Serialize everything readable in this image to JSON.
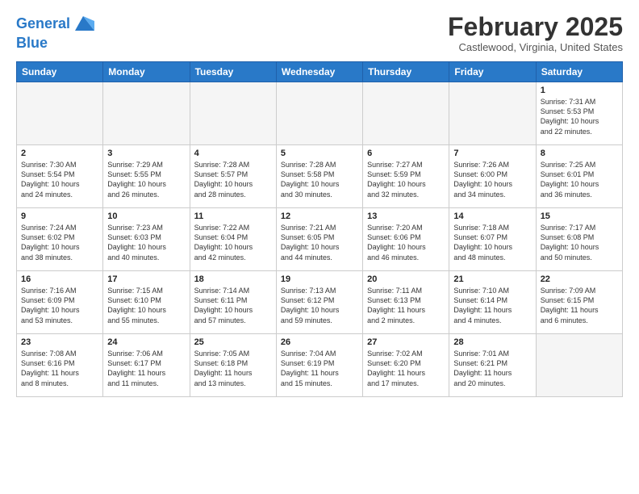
{
  "header": {
    "logo_line1": "General",
    "logo_line2": "Blue",
    "month_title": "February 2025",
    "subtitle": "Castlewood, Virginia, United States"
  },
  "weekdays": [
    "Sunday",
    "Monday",
    "Tuesday",
    "Wednesday",
    "Thursday",
    "Friday",
    "Saturday"
  ],
  "weeks": [
    [
      {
        "day": "",
        "info": ""
      },
      {
        "day": "",
        "info": ""
      },
      {
        "day": "",
        "info": ""
      },
      {
        "day": "",
        "info": ""
      },
      {
        "day": "",
        "info": ""
      },
      {
        "day": "",
        "info": ""
      },
      {
        "day": "1",
        "info": "Sunrise: 7:31 AM\nSunset: 5:53 PM\nDaylight: 10 hours\nand 22 minutes."
      }
    ],
    [
      {
        "day": "2",
        "info": "Sunrise: 7:30 AM\nSunset: 5:54 PM\nDaylight: 10 hours\nand 24 minutes."
      },
      {
        "day": "3",
        "info": "Sunrise: 7:29 AM\nSunset: 5:55 PM\nDaylight: 10 hours\nand 26 minutes."
      },
      {
        "day": "4",
        "info": "Sunrise: 7:28 AM\nSunset: 5:57 PM\nDaylight: 10 hours\nand 28 minutes."
      },
      {
        "day": "5",
        "info": "Sunrise: 7:28 AM\nSunset: 5:58 PM\nDaylight: 10 hours\nand 30 minutes."
      },
      {
        "day": "6",
        "info": "Sunrise: 7:27 AM\nSunset: 5:59 PM\nDaylight: 10 hours\nand 32 minutes."
      },
      {
        "day": "7",
        "info": "Sunrise: 7:26 AM\nSunset: 6:00 PM\nDaylight: 10 hours\nand 34 minutes."
      },
      {
        "day": "8",
        "info": "Sunrise: 7:25 AM\nSunset: 6:01 PM\nDaylight: 10 hours\nand 36 minutes."
      }
    ],
    [
      {
        "day": "9",
        "info": "Sunrise: 7:24 AM\nSunset: 6:02 PM\nDaylight: 10 hours\nand 38 minutes."
      },
      {
        "day": "10",
        "info": "Sunrise: 7:23 AM\nSunset: 6:03 PM\nDaylight: 10 hours\nand 40 minutes."
      },
      {
        "day": "11",
        "info": "Sunrise: 7:22 AM\nSunset: 6:04 PM\nDaylight: 10 hours\nand 42 minutes."
      },
      {
        "day": "12",
        "info": "Sunrise: 7:21 AM\nSunset: 6:05 PM\nDaylight: 10 hours\nand 44 minutes."
      },
      {
        "day": "13",
        "info": "Sunrise: 7:20 AM\nSunset: 6:06 PM\nDaylight: 10 hours\nand 46 minutes."
      },
      {
        "day": "14",
        "info": "Sunrise: 7:18 AM\nSunset: 6:07 PM\nDaylight: 10 hours\nand 48 minutes."
      },
      {
        "day": "15",
        "info": "Sunrise: 7:17 AM\nSunset: 6:08 PM\nDaylight: 10 hours\nand 50 minutes."
      }
    ],
    [
      {
        "day": "16",
        "info": "Sunrise: 7:16 AM\nSunset: 6:09 PM\nDaylight: 10 hours\nand 53 minutes."
      },
      {
        "day": "17",
        "info": "Sunrise: 7:15 AM\nSunset: 6:10 PM\nDaylight: 10 hours\nand 55 minutes."
      },
      {
        "day": "18",
        "info": "Sunrise: 7:14 AM\nSunset: 6:11 PM\nDaylight: 10 hours\nand 57 minutes."
      },
      {
        "day": "19",
        "info": "Sunrise: 7:13 AM\nSunset: 6:12 PM\nDaylight: 10 hours\nand 59 minutes."
      },
      {
        "day": "20",
        "info": "Sunrise: 7:11 AM\nSunset: 6:13 PM\nDaylight: 11 hours\nand 2 minutes."
      },
      {
        "day": "21",
        "info": "Sunrise: 7:10 AM\nSunset: 6:14 PM\nDaylight: 11 hours\nand 4 minutes."
      },
      {
        "day": "22",
        "info": "Sunrise: 7:09 AM\nSunset: 6:15 PM\nDaylight: 11 hours\nand 6 minutes."
      }
    ],
    [
      {
        "day": "23",
        "info": "Sunrise: 7:08 AM\nSunset: 6:16 PM\nDaylight: 11 hours\nand 8 minutes."
      },
      {
        "day": "24",
        "info": "Sunrise: 7:06 AM\nSunset: 6:17 PM\nDaylight: 11 hours\nand 11 minutes."
      },
      {
        "day": "25",
        "info": "Sunrise: 7:05 AM\nSunset: 6:18 PM\nDaylight: 11 hours\nand 13 minutes."
      },
      {
        "day": "26",
        "info": "Sunrise: 7:04 AM\nSunset: 6:19 PM\nDaylight: 11 hours\nand 15 minutes."
      },
      {
        "day": "27",
        "info": "Sunrise: 7:02 AM\nSunset: 6:20 PM\nDaylight: 11 hours\nand 17 minutes."
      },
      {
        "day": "28",
        "info": "Sunrise: 7:01 AM\nSunset: 6:21 PM\nDaylight: 11 hours\nand 20 minutes."
      },
      {
        "day": "",
        "info": ""
      }
    ]
  ]
}
